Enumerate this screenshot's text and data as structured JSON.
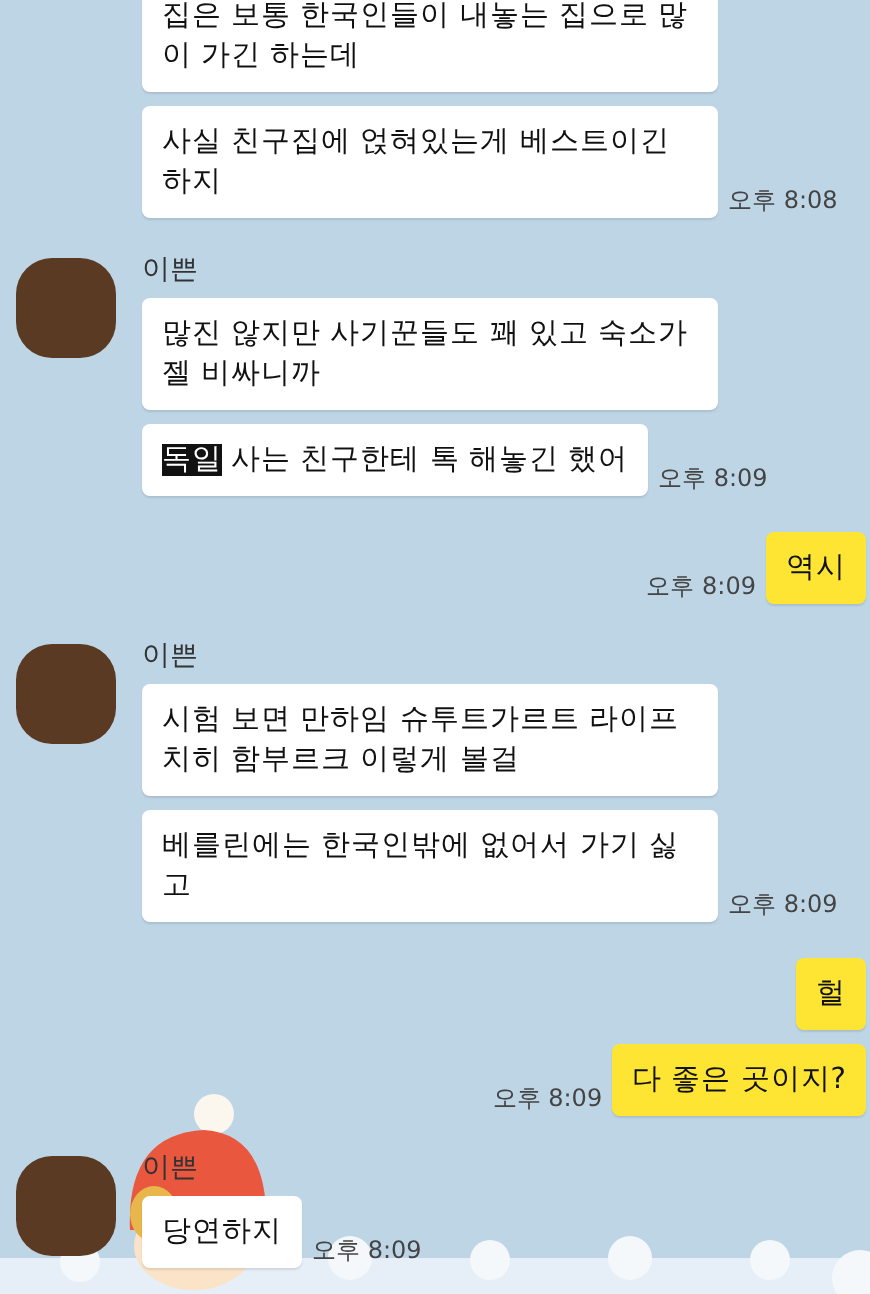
{
  "messages": [
    {
      "kind": "received",
      "bubbles": [
        {
          "text": "집은 보통 한국인들이 내놓는 집으로 많이 가긴 하는데"
        },
        {
          "text": "사실 친구집에 얹혀있는게 베스트이긴 하지"
        }
      ],
      "time": "오후 8:08"
    },
    {
      "kind": "received",
      "sender": "이쁜",
      "bubbles": [
        {
          "text": "많진 않지만 사기꾼들도 꽤 있고 숙소가 젤 비싸니까"
        },
        {
          "highlight": "독일",
          "text": "사는 친구한테 톡 해놓긴 했어"
        }
      ],
      "time": "오후 8:09"
    },
    {
      "kind": "sent",
      "bubbles": [
        {
          "text": "역시"
        }
      ],
      "time": "오후 8:09"
    },
    {
      "kind": "received",
      "sender": "이쁜",
      "bubbles": [
        {
          "text": "시험 보면 만하임 슈투트가르트 라이프치히 함부르크 이렇게 볼걸"
        },
        {
          "text": "베를린에는 한국인밖에 없어서 가기 싫고"
        }
      ],
      "time": "오후 8:09"
    },
    {
      "kind": "sent",
      "bubbles": [
        {
          "text": "헐"
        },
        {
          "text": "다 좋은 곳이지?"
        }
      ],
      "time": "오후 8:09"
    },
    {
      "kind": "received",
      "sender": "이쁜",
      "bubbles": [
        {
          "text": "당연하지"
        }
      ],
      "time": "오후 8:09"
    }
  ]
}
